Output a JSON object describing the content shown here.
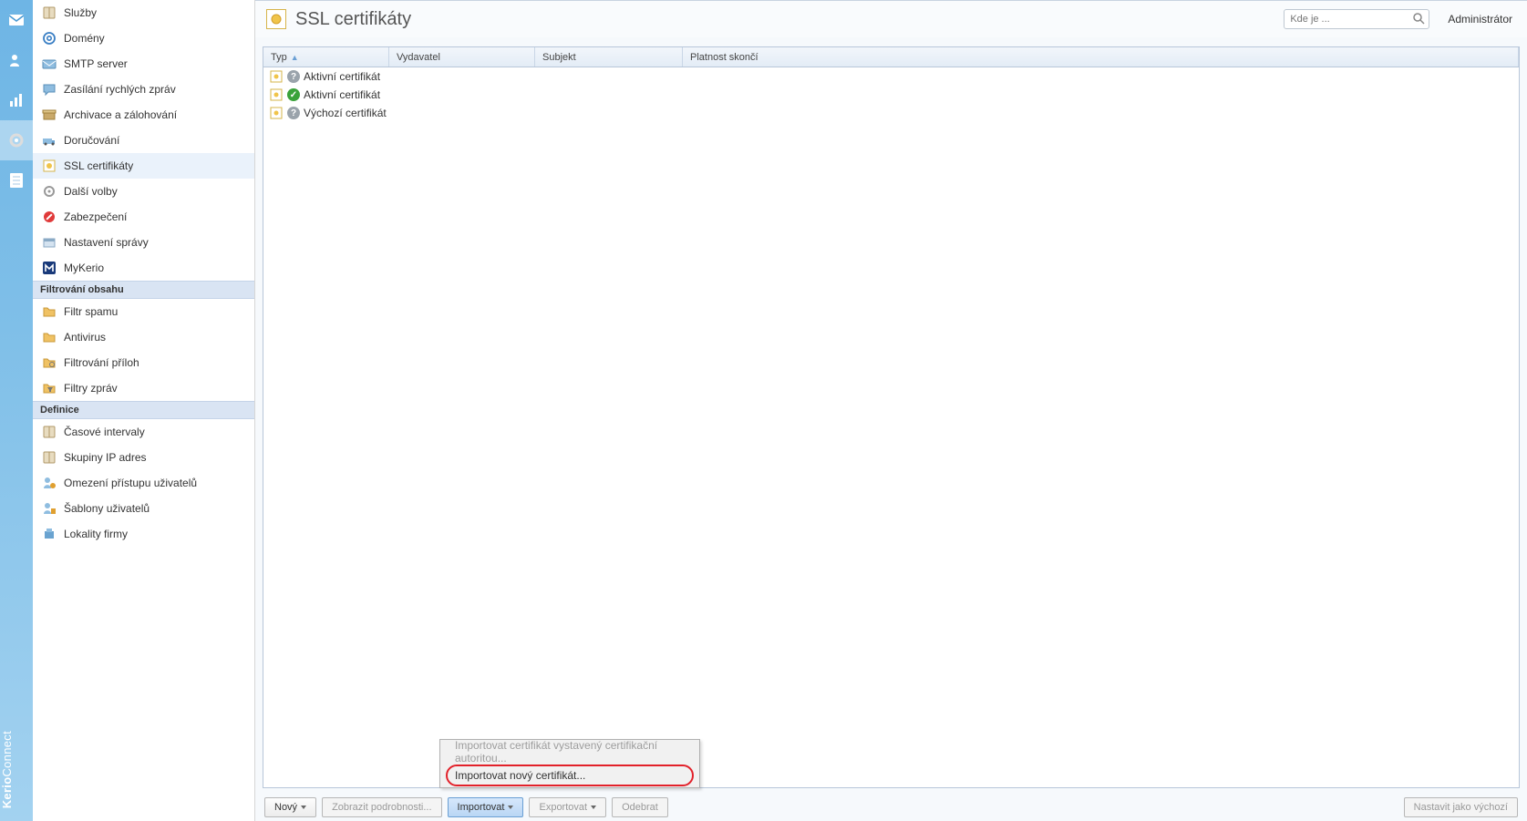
{
  "brand": {
    "part1": "Kerio",
    "part2": "Connect"
  },
  "rail": [
    "mail-icon",
    "users-icon",
    "stats-icon",
    "gear-icon",
    "notes-icon"
  ],
  "rail_active_index": 3,
  "sidebar": {
    "items": [
      {
        "label": "Služby",
        "icon": "book-icon"
      },
      {
        "label": "Domény",
        "icon": "at-icon"
      },
      {
        "label": "SMTP server",
        "icon": "smtp-icon"
      },
      {
        "label": "Zasílání rychlých zpráv",
        "icon": "chat-icon"
      },
      {
        "label": "Archivace a zálohování",
        "icon": "archive-icon"
      },
      {
        "label": "Doručování",
        "icon": "delivery-icon"
      },
      {
        "label": "SSL certifikáty",
        "icon": "ssl-icon",
        "selected": true
      },
      {
        "label": "Další volby",
        "icon": "gear-small-icon"
      },
      {
        "label": "Zabezpečení",
        "icon": "security-icon"
      },
      {
        "label": "Nastavení správy",
        "icon": "admin-icon"
      },
      {
        "label": "MyKerio",
        "icon": "mykerio-icon"
      }
    ],
    "group_filter": "Filtrování obsahu",
    "filter_items": [
      {
        "label": "Filtr spamu",
        "icon": "folder-icon"
      },
      {
        "label": "Antivirus",
        "icon": "folder-icon"
      },
      {
        "label": "Filtrování příloh",
        "icon": "folder-attach-icon"
      },
      {
        "label": "Filtry zpráv",
        "icon": "folder-filter-icon"
      }
    ],
    "group_def": "Definice",
    "def_items": [
      {
        "label": "Časové intervaly",
        "icon": "book-icon"
      },
      {
        "label": "Skupiny IP adres",
        "icon": "book-icon"
      },
      {
        "label": "Omezení přístupu uživatelů",
        "icon": "user-policy-icon"
      },
      {
        "label": "Šablony uživatelů",
        "icon": "user-template-icon"
      },
      {
        "label": "Lokality firmy",
        "icon": "sites-icon"
      }
    ]
  },
  "header": {
    "title": "SSL certifikáty",
    "search_placeholder": "Kde je ...",
    "admin_label": "Administrátor"
  },
  "grid": {
    "columns": {
      "typ": "Typ",
      "vydavatel": "Vydavatel",
      "subjekt": "Subjekt",
      "platnost": "Platnost skončí"
    },
    "sort_indicator": "▲",
    "rows": [
      {
        "status": "unknown",
        "label": "Aktivní certifikát"
      },
      {
        "status": "ok",
        "label": "Aktivní certifikát"
      },
      {
        "status": "unknown",
        "label": "Výchozí certifikát"
      }
    ]
  },
  "menu": {
    "item_disabled": "Importovat certifikát vystavený certifikační autoritou...",
    "item_active": "Importovat nový certifikát..."
  },
  "toolbar": {
    "new": "Nový",
    "details": "Zobrazit podrobnosti...",
    "import": "Importovat",
    "export": "Exportovat",
    "remove": "Odebrat",
    "set_default": "Nastavit jako výchozí"
  }
}
